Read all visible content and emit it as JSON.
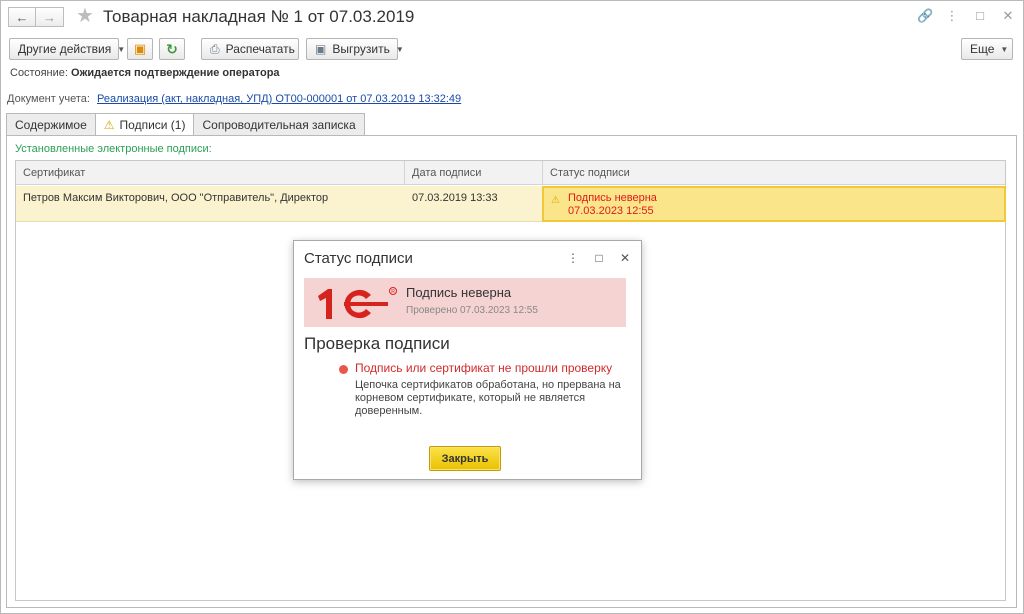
{
  "window": {
    "title": "Товарная накладная № 1 от 07.03.2019",
    "back_icon": "arrow-left-icon",
    "forward_icon": "arrow-right-icon",
    "favorite_icon": "star-icon",
    "link_icon": "link-icon",
    "menu_icon": "more-icon",
    "maximize_icon": "maximize-icon",
    "close_icon": "close-icon"
  },
  "toolbar": {
    "other_actions": "Другие действия",
    "print": "Распечатать",
    "export": "Выгрузить",
    "more": "Еще"
  },
  "state": {
    "label": "Состояние:",
    "value": "Ожидается подтверждение оператора"
  },
  "document": {
    "label": "Документ учета:",
    "link": "Реализация (акт, накладная, УПД) ОТ00-000001 от 07.03.2019 13:32:49"
  },
  "tabs": [
    {
      "label": "Содержимое",
      "active": false
    },
    {
      "label": "Подписи (1)",
      "active": true
    },
    {
      "label": "Сопроводительная записка",
      "active": false
    }
  ],
  "signatures": {
    "section_label": "Установленные электронные подписи:",
    "columns": [
      "Сертификат",
      "Дата подписи",
      "Статус подписи"
    ],
    "rows": [
      {
        "certificate": "Петров Максим Викторович, ООО \"Отправитель\", Директор",
        "date": "07.03.2019 13:33",
        "status": "Подпись неверна",
        "status_date": "07.03.2023 12:55"
      }
    ]
  },
  "dialog": {
    "title": "Статус подписи",
    "banner_status": "Подпись неверна",
    "banner_checked": "Проверено 07.03.2023 12:55",
    "check_heading": "Проверка подписи",
    "result": "Подпись или сертификат не прошли проверку",
    "description": "Цепочка сертификатов обработана, но прервана на корневом сертификате, который не является доверенным.",
    "close_button": "Закрыть"
  },
  "colors": {
    "accent_yellow": "#f0c83a",
    "error_red": "#e01a1a",
    "banner_bg": "#f6d3d3",
    "section_green": "#2aa054",
    "link_blue": "#1a4aa8"
  }
}
